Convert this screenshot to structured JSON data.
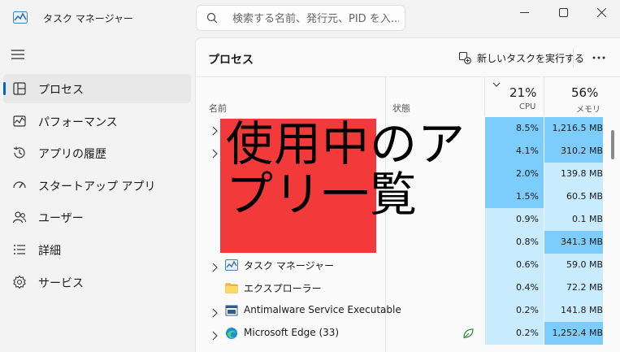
{
  "app": {
    "title": "タスク マネージャー"
  },
  "search": {
    "placeholder": "検索する名前、発行元、PID を入..."
  },
  "colors": {
    "accent": "#0067c0",
    "heat_strong": "#7ccdfb",
    "heat_light": "#c8ebfd",
    "overlay_red": "#f23a3a"
  },
  "sidebar": {
    "items": [
      {
        "label": "プロセス",
        "icon": "processes-icon",
        "active": true
      },
      {
        "label": "パフォーマンス",
        "icon": "performance-icon",
        "active": false
      },
      {
        "label": "アプリの履歴",
        "icon": "history-icon",
        "active": false
      },
      {
        "label": "スタートアップ アプリ",
        "icon": "startup-icon",
        "active": false
      },
      {
        "label": "ユーザー",
        "icon": "users-icon",
        "active": false
      },
      {
        "label": "詳細",
        "icon": "details-icon",
        "active": false
      },
      {
        "label": "サービス",
        "icon": "services-icon",
        "active": false
      }
    ]
  },
  "main": {
    "title": "プロセス",
    "run_task_label": "新しいタスクを実行する",
    "columns": {
      "name": "名前",
      "status": "状態",
      "cpu_percent": "21%",
      "cpu_label": "CPU",
      "memory_percent": "56%",
      "memory_label": "メモリ"
    },
    "overlay_text": "使用中のアプリ一覧",
    "rows": [
      {
        "name": "",
        "expandable": true,
        "cpu": "8.5%",
        "memory": "1,216.5 MB",
        "cpu_level": "strong",
        "mem_level": "strong"
      },
      {
        "name": "",
        "expandable": true,
        "cpu": "4.1%",
        "memory": "310.2 MB",
        "cpu_level": "strong",
        "mem_level": "strong"
      },
      {
        "name": "",
        "expandable": false,
        "cpu": "2.0%",
        "memory": "139.8 MB",
        "cpu_level": "strong",
        "mem_level": "light"
      },
      {
        "name": "",
        "expandable": false,
        "cpu": "1.5%",
        "memory": "60.5 MB",
        "cpu_level": "strong",
        "mem_level": "light"
      },
      {
        "name": "",
        "expandable": false,
        "cpu": "0.9%",
        "memory": "0.1 MB",
        "cpu_level": "light",
        "mem_level": "light"
      },
      {
        "name": "",
        "expandable": false,
        "cpu": "0.8%",
        "memory": "341.3 MB",
        "cpu_level": "light",
        "mem_level": "strong"
      },
      {
        "name": "タスク マネージャー",
        "icon": "task-manager-icon",
        "expandable": true,
        "cpu": "0.6%",
        "memory": "59.0 MB",
        "cpu_level": "light",
        "mem_level": "light"
      },
      {
        "name": "エクスプローラー",
        "icon": "folder-icon",
        "expandable": false,
        "cpu": "0.4%",
        "memory": "72.2 MB",
        "cpu_level": "light",
        "mem_level": "light"
      },
      {
        "name": "Antimalware Service Executable",
        "icon": "service-app-icon",
        "expandable": true,
        "cpu": "0.2%",
        "memory": "141.8 MB",
        "cpu_level": "light",
        "mem_level": "light"
      },
      {
        "name": "Microsoft Edge (33)",
        "icon": "edge-icon",
        "expandable": true,
        "status_icon": "efficiency-leaf-icon",
        "cpu": "0.2%",
        "memory": "1,252.4 MB",
        "cpu_level": "light",
        "mem_level": "strong"
      }
    ]
  }
}
